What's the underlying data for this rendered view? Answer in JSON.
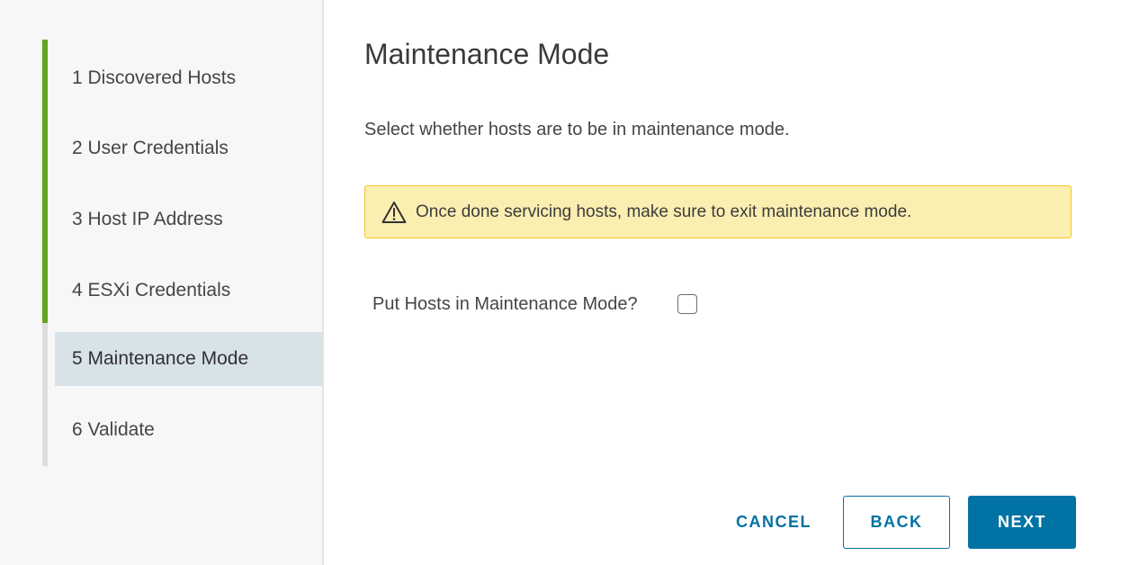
{
  "wizard": {
    "steps": [
      {
        "label": "1 Discovered Hosts",
        "state": "completed"
      },
      {
        "label": "2 User Credentials",
        "state": "completed"
      },
      {
        "label": "3 Host IP Address",
        "state": "completed"
      },
      {
        "label": "4 ESXi Credentials",
        "state": "completed"
      },
      {
        "label": "5 Maintenance Mode",
        "state": "active"
      },
      {
        "label": "6 Validate",
        "state": "pending"
      }
    ],
    "colors": {
      "completed_track": "#62a420",
      "active_step_bg": "#d8e3e9",
      "primary": "#0072a3",
      "warning_bg": "#fbeeb1",
      "warning_border": "#f5c628"
    }
  },
  "main": {
    "title": "Maintenance Mode",
    "description": "Select whether hosts are to be in maintenance mode.",
    "alert": {
      "icon": "warning-icon",
      "text": "Once done servicing hosts, make sure to exit maintenance mode."
    },
    "maintenance_checkbox": {
      "label": "Put Hosts in Maintenance Mode?",
      "checked": false
    }
  },
  "footer": {
    "cancel_label": "CANCEL",
    "back_label": "BACK",
    "next_label": "NEXT"
  }
}
